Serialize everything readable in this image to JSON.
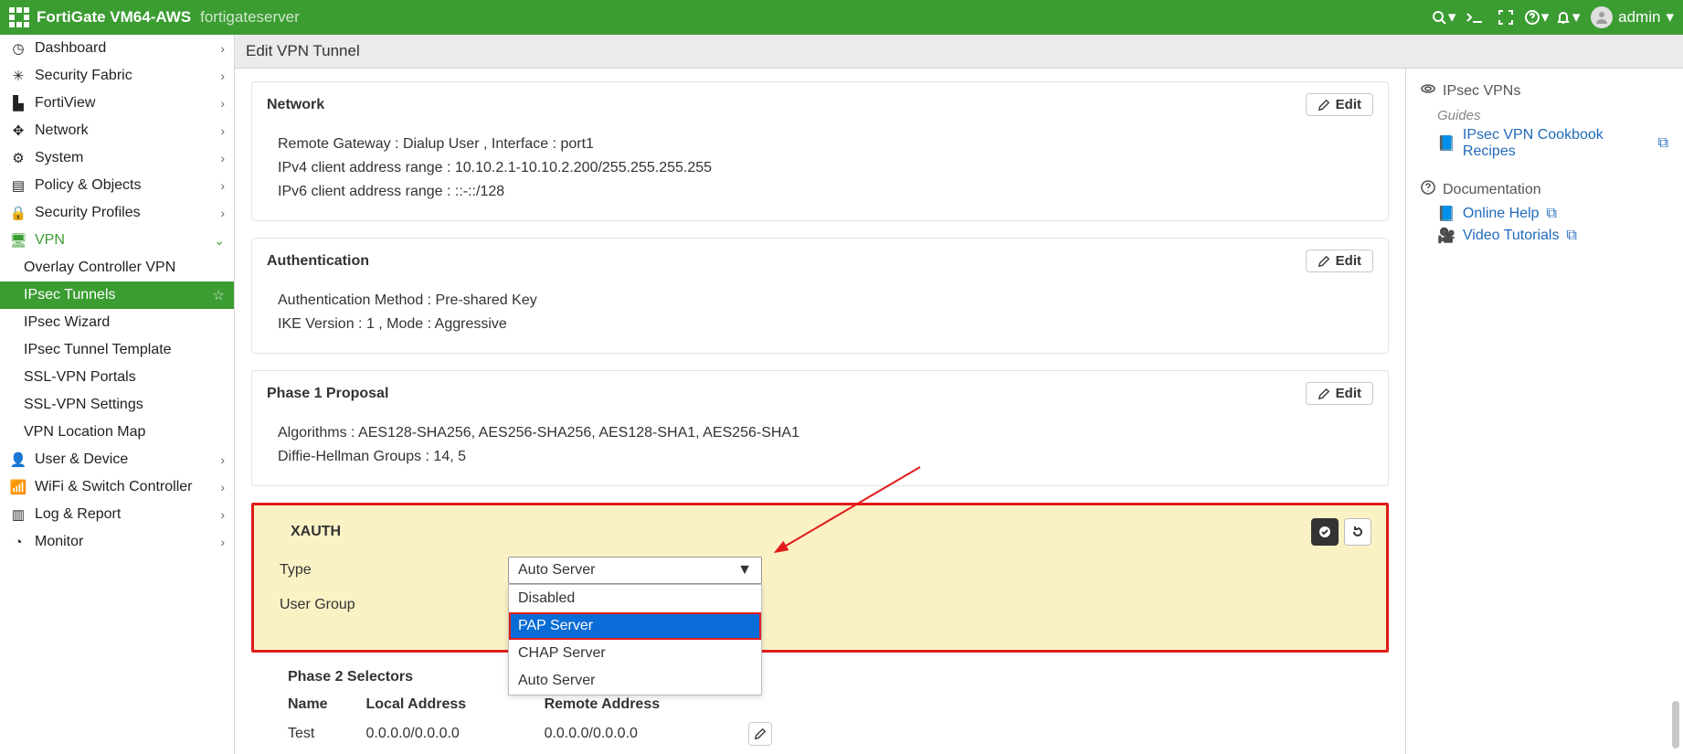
{
  "header": {
    "product": "FortiGate VM64-AWS",
    "hostname": "fortigateserver",
    "user": "admin"
  },
  "page": {
    "title": "Edit VPN Tunnel"
  },
  "sidebar": {
    "items": [
      {
        "label": "Dashboard",
        "icon": "tachometer"
      },
      {
        "label": "Security Fabric",
        "icon": "fabric"
      },
      {
        "label": "FortiView",
        "icon": "chart"
      },
      {
        "label": "Network",
        "icon": "move"
      },
      {
        "label": "System",
        "icon": "gear"
      },
      {
        "label": "Policy & Objects",
        "icon": "policy"
      },
      {
        "label": "Security Profiles",
        "icon": "lock"
      },
      {
        "label": "VPN",
        "icon": "laptop"
      },
      {
        "label": "User & Device",
        "icon": "user"
      },
      {
        "label": "WiFi & Switch Controller",
        "icon": "wifi"
      },
      {
        "label": "Log & Report",
        "icon": "bars"
      },
      {
        "label": "Monitor",
        "icon": "pie"
      }
    ],
    "vpn_children": [
      {
        "label": "Overlay Controller VPN"
      },
      {
        "label": "IPsec Tunnels"
      },
      {
        "label": "IPsec Wizard"
      },
      {
        "label": "IPsec Tunnel Template"
      },
      {
        "label": "SSL-VPN Portals"
      },
      {
        "label": "SSL-VPN Settings"
      },
      {
        "label": "VPN Location Map"
      }
    ]
  },
  "network_panel": {
    "title": "Network",
    "edit": "Edit",
    "lines": [
      "Remote Gateway : Dialup User , Interface : port1",
      "IPv4 client address range : 10.10.2.1-10.10.2.200/255.255.255.255",
      "IPv6 client address range : ::-::/128"
    ]
  },
  "auth_panel": {
    "title": "Authentication",
    "edit": "Edit",
    "lines": [
      "Authentication Method : Pre-shared Key",
      "IKE Version : 1 , Mode : Aggressive"
    ]
  },
  "phase1_panel": {
    "title": "Phase 1 Proposal",
    "edit": "Edit",
    "lines": [
      "Algorithms : AES128-SHA256, AES256-SHA256, AES128-SHA1, AES256-SHA1",
      "Diffie-Hellman Groups : 14, 5"
    ]
  },
  "xauth": {
    "title": "XAUTH",
    "type_label": "Type",
    "usergroup_label": "User Group",
    "selected": "Auto Server",
    "options": [
      "Disabled",
      "PAP Server",
      "CHAP Server",
      "Auto Server"
    ],
    "highlight_index": 1
  },
  "phase2": {
    "title": "Phase 2 Selectors",
    "cols": [
      "Name",
      "Local Address",
      "Remote Address"
    ],
    "rows": [
      {
        "name": "Test",
        "local": "0.0.0.0/0.0.0.0",
        "remote": "0.0.0.0/0.0.0.0"
      }
    ]
  },
  "right": {
    "ipsec_title": "IPsec VPNs",
    "guides": "Guides",
    "cookbook": "IPsec VPN Cookbook Recipes",
    "doc_title": "Documentation",
    "online_help": "Online Help",
    "video": "Video Tutorials"
  }
}
